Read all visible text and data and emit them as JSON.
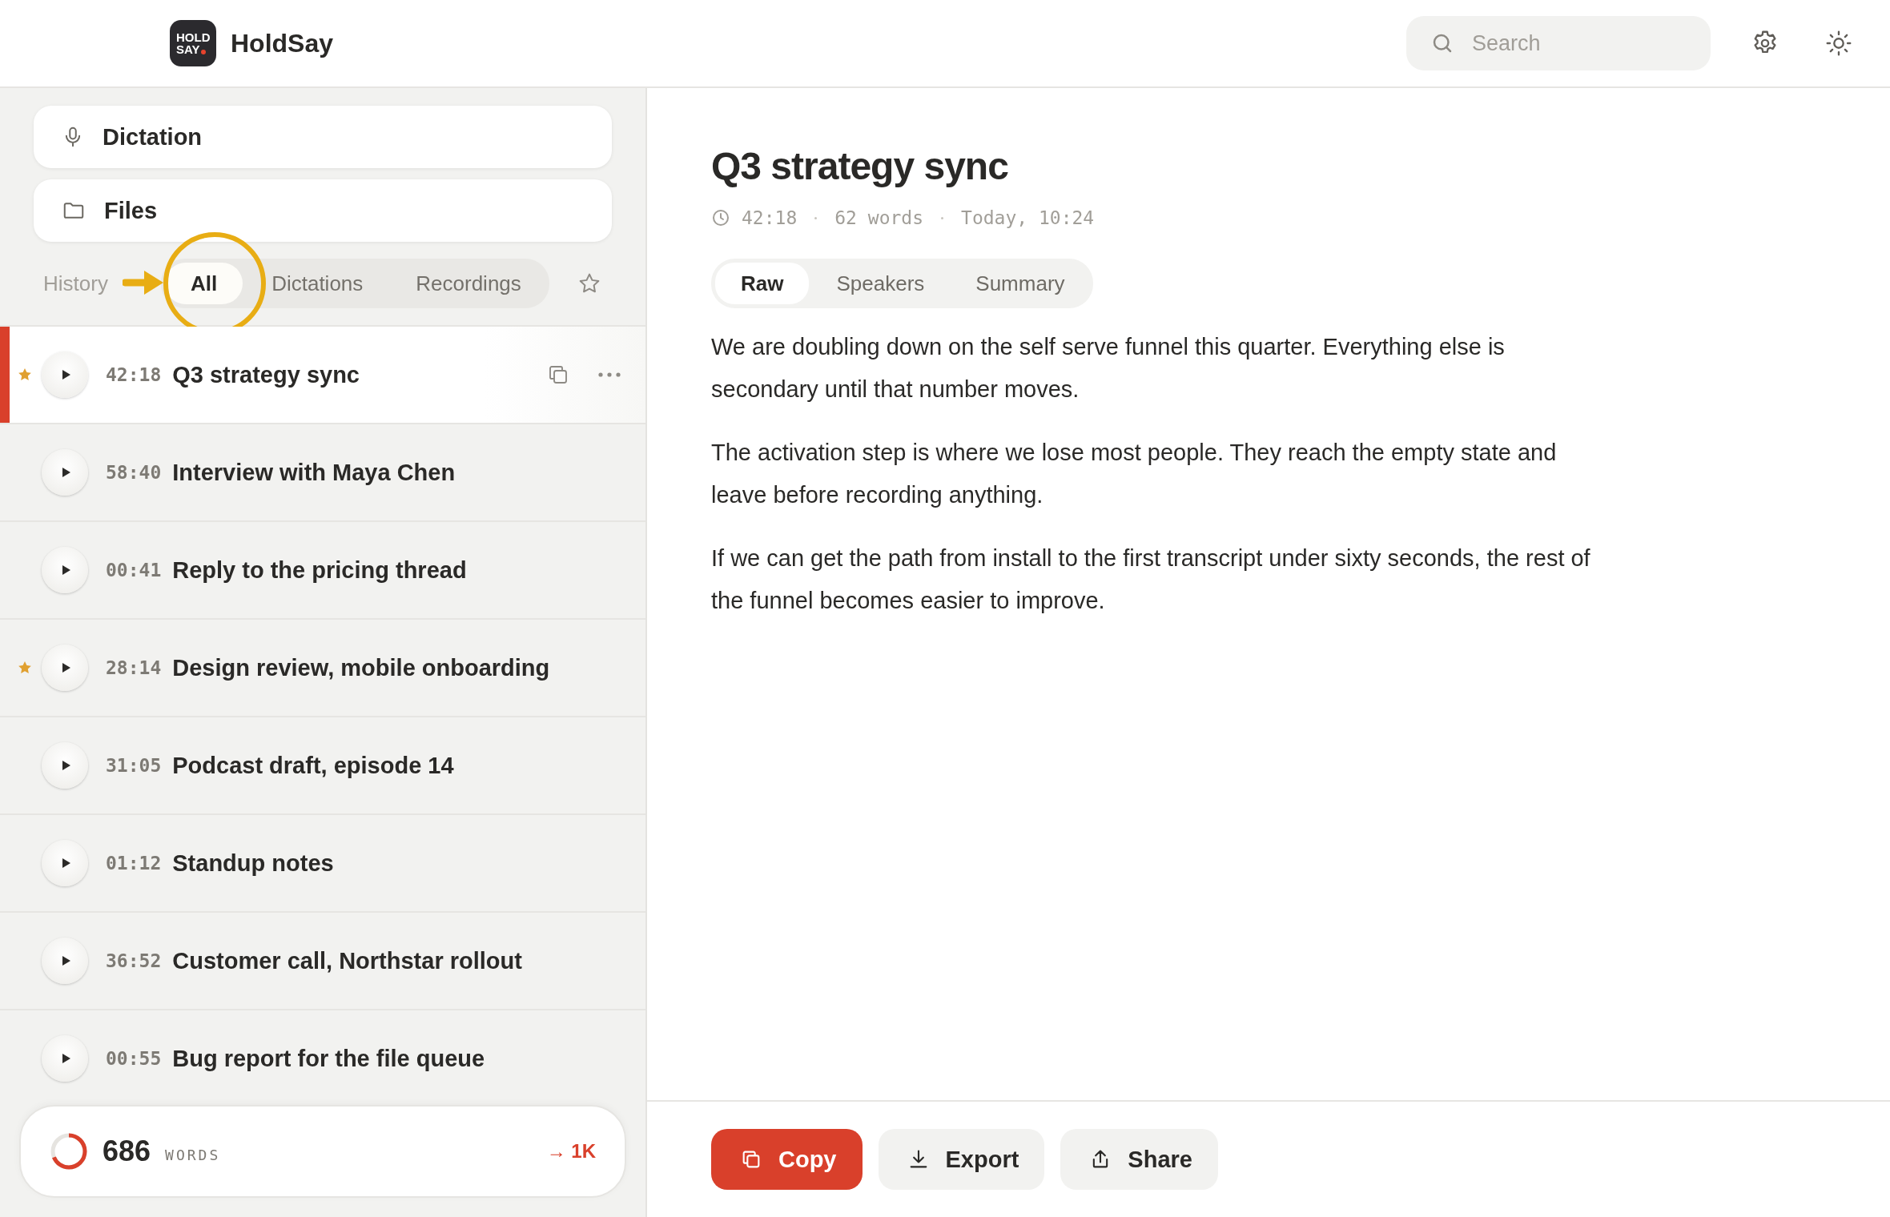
{
  "app": {
    "logo_line1": "HOLD",
    "logo_line2": "SAY",
    "name": "HoldSay"
  },
  "search": {
    "placeholder": "Search"
  },
  "nav": [
    {
      "label": "Dictation",
      "kind": "mic"
    },
    {
      "label": "Files",
      "kind": "folder"
    }
  ],
  "history": {
    "label": "History",
    "filters": [
      {
        "label": "All",
        "selected": true
      },
      {
        "label": "Dictations",
        "selected": false
      },
      {
        "label": "Recordings",
        "selected": false
      }
    ],
    "starred_only": false
  },
  "recordings": [
    {
      "duration": "42:18",
      "title": "Q3 strategy sync",
      "starred": true,
      "selected": true
    },
    {
      "duration": "58:40",
      "title": "Interview with Maya Chen",
      "starred": false,
      "selected": false
    },
    {
      "duration": "00:41",
      "title": "Reply to the pricing thread",
      "starred": false,
      "selected": false
    },
    {
      "duration": "28:14",
      "title": "Design review, mobile onboarding",
      "starred": true,
      "selected": false
    },
    {
      "duration": "31:05",
      "title": "Podcast draft, episode 14",
      "starred": false,
      "selected": false
    },
    {
      "duration": "01:12",
      "title": "Standup notes",
      "starred": false,
      "selected": false
    },
    {
      "duration": "36:52",
      "title": "Customer call, Northstar rollout",
      "starred": false,
      "selected": false
    },
    {
      "duration": "00:55",
      "title": "Bug report for the file queue",
      "starred": false,
      "selected": false
    }
  ],
  "word_goal": {
    "count": "686",
    "unit": "WORDS",
    "level": 0.686,
    "goal": "→ 1K"
  },
  "document": {
    "title": "Q3 strategy sync",
    "duration": "42:18",
    "words": "62 words",
    "date": "Today, 10:24",
    "tabs": [
      {
        "label": "Raw",
        "selected": true
      },
      {
        "label": "Speakers",
        "selected": false
      },
      {
        "label": "Summary",
        "selected": false
      }
    ],
    "paragraphs": [
      "We are doubling down on the self serve funnel this quarter. Everything else is secondary until that number moves.",
      "The activation step is where we lose most people. They reach the empty state and leave before recording anything.",
      "If we can get the path from install to the first transcript under sixty seconds, the rest of the funnel becomes easier to improve."
    ]
  },
  "actions": [
    {
      "label": "Copy",
      "kind": "copy",
      "primary": true
    },
    {
      "label": "Export",
      "kind": "export",
      "primary": false
    },
    {
      "label": "Share",
      "kind": "share",
      "primary": false
    }
  ]
}
